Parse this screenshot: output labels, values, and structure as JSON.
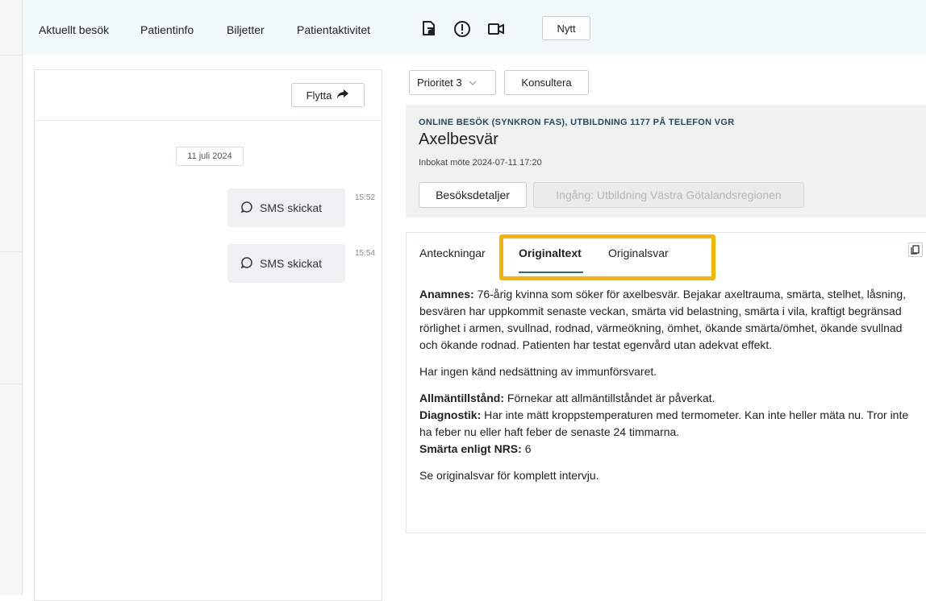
{
  "nav": {
    "items": [
      "Aktuellt besök",
      "Patientinfo",
      "Biljetter",
      "Patientaktivitet"
    ],
    "icons": [
      "document-icon",
      "alert-icon",
      "video-icon"
    ],
    "new_label": "Nytt"
  },
  "chat": {
    "move_label": "Flytta",
    "date": "11 juli 2024",
    "messages": [
      {
        "text": "SMS skickat",
        "time": "15:52"
      },
      {
        "text": "SMS skickat",
        "time": "15:54"
      }
    ]
  },
  "actions": {
    "priority": "Prioritet 3",
    "consult": "Konsultera"
  },
  "visit": {
    "tag": "ONLINE BESÖK (SYNKRON FAS), UTBILDNING 1177 PÅ TELEFON VGR",
    "title": "Axelbesvär",
    "booked": "Inbokat möte 2024-07-11 17:20",
    "details_btn": "Besöksdetaljer",
    "entry_btn": "Ingång: Utbildning Västra Götalandsregionen"
  },
  "notes": {
    "tabs": [
      "Anteckningar",
      "Originaltext",
      "Originalsvar"
    ],
    "active_tab": "Originaltext",
    "anamnes_label": "Anamnes:",
    "anamnes_text": " 76-årig kvinna som söker för axelbesvär. Bejakar axeltrauma, smärta, stelhet, låsning, besvären har uppkommit senaste veckan, smärta vid belastning, smärta i vila, kraftigt begränsad rörlighet i armen, svullnad, rodnad, värmeökning, ömhet, ökande smärta/ömhet, ökande svullnad och ökande rodnad. Patienten har testat egenvård utan adekvat effekt.",
    "immune": "Har ingen känd nedsättning av immunförsvaret.",
    "general_label": "Allmäntillstånd:",
    "general_text": " Förnekar att allmäntillståndet är påverkat.",
    "diag_label": "Diagnostik:",
    "diag_text": " Har inte mätt kroppstemperaturen med termometer. Kan inte heller mäta nu. Tror inte ha feber nu eller haft feber de senaste 24 timmarna.",
    "nrs_label": "Smärta enligt NRS:",
    "nrs_value": " 6",
    "footer": "Se originalsvar för komplett intervju."
  },
  "colors": {
    "accent": "#2b6f73",
    "highlight": "#f6b600",
    "topbar": "#f1f9fb"
  }
}
